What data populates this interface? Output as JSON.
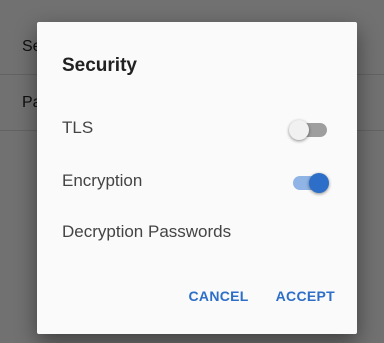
{
  "background": {
    "rows": [
      {
        "label": "Se"
      },
      {
        "label": "Pa"
      }
    ]
  },
  "dialog": {
    "title": "Security",
    "items": [
      {
        "label": "TLS",
        "type": "toggle",
        "checked": false
      },
      {
        "label": "Encryption",
        "type": "toggle",
        "checked": true
      },
      {
        "label": "Decryption Passwords",
        "type": "link"
      }
    ],
    "buttons": {
      "cancel": "CANCEL",
      "accept": "ACCEPT"
    }
  },
  "colors": {
    "accent": "#2d6ec8",
    "accent_track": "#8fb4e5",
    "toggle_off_track": "#9e9e9e",
    "dialog_background": "#fafafa"
  }
}
